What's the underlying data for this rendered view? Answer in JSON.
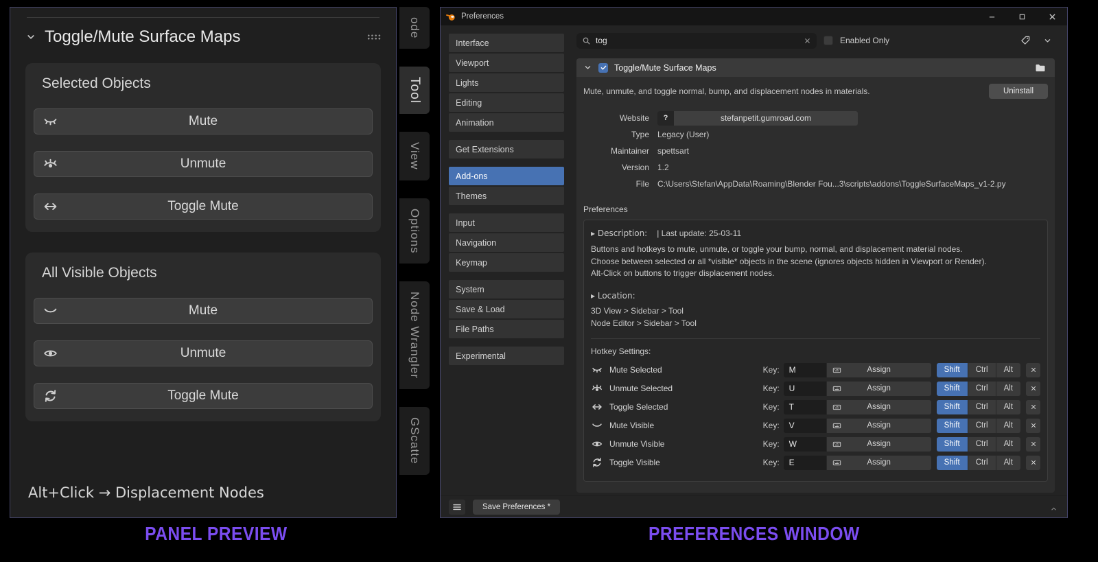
{
  "colors": {
    "accent": "#7b4df0",
    "selection_blue": "#4772b3"
  },
  "captions": {
    "left": "PANEL PREVIEW",
    "right": "PREFERENCES WINDOW"
  },
  "panel": {
    "title": "Toggle/Mute Surface Maps",
    "sections": [
      {
        "heading": "Selected Objects",
        "buttons": [
          {
            "label": "Mute",
            "icon": "eye-closed-lashes-icon"
          },
          {
            "label": "Unmute",
            "icon": "eye-open-lashes-icon"
          },
          {
            "label": "Toggle Mute",
            "icon": "arrows-horizontal-icon"
          }
        ]
      },
      {
        "heading": "All Visible Objects",
        "buttons": [
          {
            "label": "Mute",
            "icon": "eye-closed-icon"
          },
          {
            "label": "Unmute",
            "icon": "eye-open-icon"
          },
          {
            "label": "Toggle Mute",
            "icon": "refresh-icon"
          }
        ]
      }
    ],
    "footer": "Alt+Click → Displacement Nodes",
    "tabs": [
      {
        "label": "ode",
        "active": false
      },
      {
        "label": "Tool",
        "active": true
      },
      {
        "label": "View",
        "active": false
      },
      {
        "label": "Options",
        "active": false
      },
      {
        "label": "Node Wrangler",
        "active": false
      },
      {
        "label": "GScatte",
        "active": false
      }
    ]
  },
  "window": {
    "title": "Preferences",
    "search": {
      "value": "tog"
    },
    "enabled_only_label": "Enabled Only",
    "nav": {
      "selected": "Add-ons",
      "groups": [
        {
          "items": [
            "Interface",
            "Viewport",
            "Lights",
            "Editing",
            "Animation"
          ]
        },
        {
          "items": [
            "Get Extensions"
          ]
        },
        {
          "items": [
            "Add-ons",
            "Themes"
          ]
        },
        {
          "items": [
            "Input",
            "Navigation",
            "Keymap"
          ]
        },
        {
          "items": [
            "System",
            "Save & Load",
            "File Paths"
          ]
        },
        {
          "items": [
            "Experimental"
          ]
        }
      ]
    },
    "addon": {
      "name": "Toggle/Mute Surface Maps",
      "summary": "Mute, unmute, and toggle normal, bump, and displacement nodes in materials.",
      "uninstall_label": "Uninstall",
      "fields": {
        "website": {
          "label": "Website",
          "value": "stefanpetit.gumroad.com"
        },
        "type": {
          "label": "Type",
          "value": "Legacy (User)"
        },
        "maintainer": {
          "label": "Maintainer",
          "value": "spettsart"
        },
        "version": {
          "label": "Version",
          "value": "1.2"
        },
        "file": {
          "label": "File",
          "value": "C:\\Users\\Stefan\\AppData\\Roaming\\Blender Fou...3\\scripts\\addons\\ToggleSurfaceMaps_v1-2.py"
        }
      },
      "preferences_label": "Preferences",
      "prefs": {
        "description_heading": "▸ Description:",
        "last_update": "| Last update: 25-03-11",
        "description_lines": [
          "Buttons and hotkeys to mute, unmute, or toggle your bump, normal, and displacement material nodes.",
          "Choose between selected or all *visible* objects in the scene (ignores objects hidden in Viewport or Render).",
          "Alt-Click on buttons to trigger displacement nodes."
        ],
        "location_heading": "▸ Location:",
        "location_lines": [
          "3D View > Sidebar > Tool",
          "Node Editor > Sidebar > Tool"
        ],
        "hotkeys_heading": "Hotkey Settings:",
        "key_label": "Key:",
        "assign_label": "Assign",
        "modifiers": [
          "Shift",
          "Ctrl",
          "Alt"
        ],
        "rows": [
          {
            "label": "Mute Selected",
            "key": "M",
            "icon": "eye-closed-lashes-icon"
          },
          {
            "label": "Unmute Selected",
            "key": "U",
            "icon": "eye-open-lashes-icon"
          },
          {
            "label": "Toggle Selected",
            "key": "T",
            "icon": "arrows-horizontal-icon"
          },
          {
            "label": "Mute Visible",
            "key": "V",
            "icon": "eye-closed-icon"
          },
          {
            "label": "Unmute Visible",
            "key": "W",
            "icon": "eye-open-icon"
          },
          {
            "label": "Toggle Visible",
            "key": "E",
            "icon": "refresh-icon"
          }
        ]
      }
    },
    "footer": {
      "save_label": "Save Preferences *"
    }
  }
}
